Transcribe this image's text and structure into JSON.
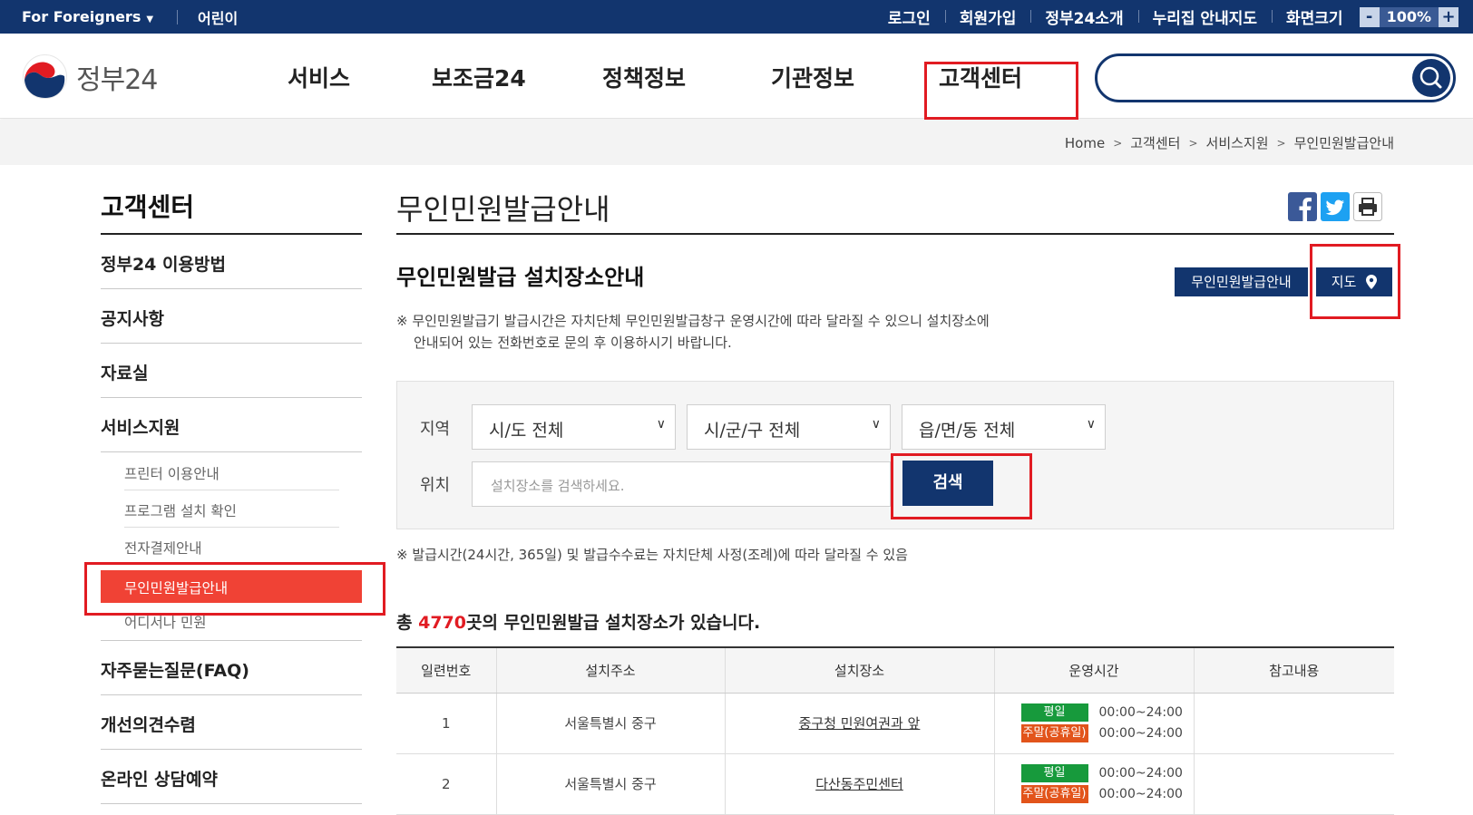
{
  "topbar": {
    "foreigners": "For Foreigners",
    "kids": "어린이",
    "login": "로그인",
    "join": "회원가입",
    "about": "정부24소개",
    "sitemap": "누리집 안내지도",
    "screen_size": "화면크기",
    "zoom_out": "-",
    "zoom_value": "100%",
    "zoom_in": "+"
  },
  "header": {
    "logo_text": "정부24",
    "nav": [
      "서비스",
      "보조금24",
      "정책정보",
      "기관정보",
      "고객센터"
    ],
    "search_placeholder": ""
  },
  "breadcrumb": [
    "Home",
    "고객센터",
    "서비스지원",
    "무인민원발급안내"
  ],
  "sidebar": {
    "title": "고객센터",
    "items": [
      "정부24 이용방법",
      "공지사항",
      "자료실",
      "서비스지원"
    ],
    "subitems": [
      "프린터 이용안내",
      "프로그램 설치 확인",
      "전자결제안내",
      "무인민원발급안내",
      "어디서나 민원"
    ],
    "items_after": [
      "자주묻는질문(FAQ)",
      "개선의견수렴",
      "온라인 상담예약"
    ]
  },
  "main": {
    "page_title": "무인민원발급안내",
    "section_title": "무인민원발급 설치장소안내",
    "btn_guide": "무인민원발급안내",
    "btn_map": "지도",
    "notice1_line1": "※ 무인민원발급기 발급시간은 자치단체 무인민원발급창구 운영시간에 따라 달라질 수 있으니 설치장소에",
    "notice1_line2": "안내되어 있는 전화번호로 문의 후 이용하시기 바랍니다.",
    "filter": {
      "region_label": "지역",
      "location_label": "위치",
      "sido": "시/도 전체",
      "sigungu": "시/군/구 전체",
      "eupmyeon": "읍/면/동 전체",
      "placeholder": "설치장소를 검색하세요.",
      "search_btn": "검색"
    },
    "notice2": "※ 발급시간(24시간, 365일) 및 발급수수료는 자치단체 사정(조례)에 따라 달라질 수 있음",
    "count_prefix": "총 ",
    "count_num": "4770",
    "count_suffix": "곳의 무인민원발급 설치장소가 있습니다.",
    "table": {
      "headers": [
        "일련번호",
        "설치주소",
        "설치장소",
        "운영시간",
        "참고내용"
      ],
      "rows": [
        {
          "no": "1",
          "addr": "서울특별시 중구",
          "place": "중구청 민원여권과 앞",
          "weekday_tag": "평일",
          "weekday_time": "00:00~24:00",
          "weekend_tag": "주말(공휴일)",
          "weekend_time": "00:00~24:00",
          "note": ""
        },
        {
          "no": "2",
          "addr": "서울특별시 중구",
          "place": "다산동주민센터",
          "weekday_tag": "평일",
          "weekday_time": "00:00~24:00",
          "weekend_tag": "주말(공휴일)",
          "weekend_time": "00:00~24:00",
          "note": ""
        }
      ]
    }
  },
  "colors": {
    "navy": "#12356e",
    "highlight": "#e11b22",
    "active_menu": "#f04235",
    "tag_green": "#179a3c",
    "tag_orange": "#e2541b"
  }
}
